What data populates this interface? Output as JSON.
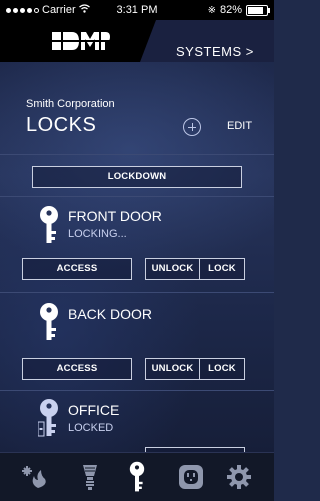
{
  "status_bar": {
    "carrier": "Carrier",
    "time": "3:31 PM",
    "battery": "82%"
  },
  "header": {
    "brand": "DMP",
    "systems_label": "SYSTEMS >"
  },
  "page": {
    "company": "Smith Corporation",
    "title": "LOCKS",
    "edit_label": "EDIT"
  },
  "lockdown_label": "LOCKDOWN",
  "locks": [
    {
      "name": "FRONT DOOR",
      "status": "LOCKING...",
      "access_label": "ACCESS",
      "unlock_label": "UNLOCK",
      "lock_label": "LOCK"
    },
    {
      "name": "BACK DOOR",
      "status": "",
      "access_label": "ACCESS",
      "unlock_label": "UNLOCK",
      "lock_label": "LOCK"
    },
    {
      "name": "OFFICE",
      "status": "LOCKED"
    }
  ],
  "nav": {
    "items": [
      "fire-icon",
      "light-bulb-icon",
      "key-icon",
      "outlet-icon",
      "gear-icon"
    ],
    "active": "key-icon"
  },
  "colors": {
    "accent": "#c9d1ef",
    "background": "#1f2a4a"
  }
}
